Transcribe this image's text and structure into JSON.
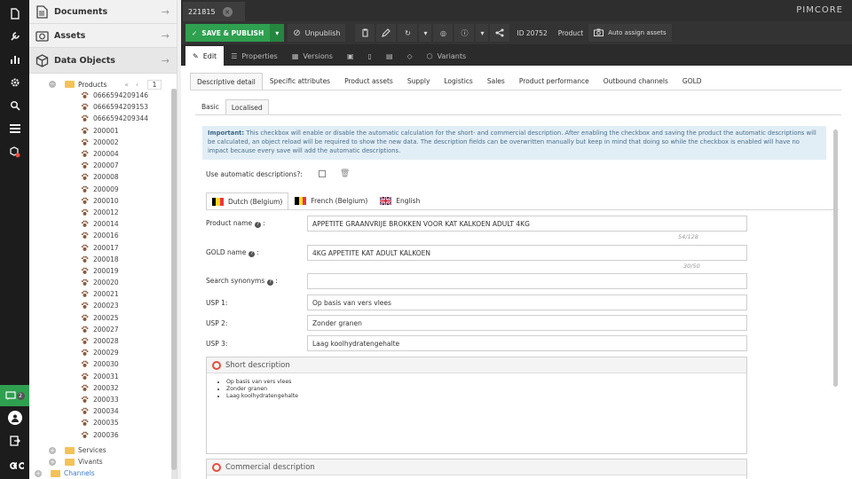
{
  "tree": {
    "sections": [
      {
        "label": "Documents",
        "icon": "document-icon"
      },
      {
        "label": "Assets",
        "icon": "image-icon"
      },
      {
        "label": "Data Objects",
        "icon": "cube-icon"
      }
    ],
    "products_label": "Products",
    "pager_page": "1",
    "items": [
      "0666594209146",
      "0666594209153",
      "0666594209344",
      "200001",
      "200002",
      "200004",
      "200007",
      "200008",
      "200009",
      "200010",
      "200012",
      "200014",
      "200016",
      "200017",
      "200018",
      "200019",
      "200020",
      "200021",
      "200023",
      "200025",
      "200027",
      "200028",
      "200029",
      "200030",
      "200031",
      "200032",
      "200033",
      "200034",
      "200035",
      "200036"
    ],
    "siblings": [
      "Services",
      "Vivants",
      "Channels"
    ]
  },
  "tab": {
    "id": "221815"
  },
  "brand": "PIMCORE",
  "toolbar": {
    "save_publish": "SAVE & PUBLISH",
    "unpublish": "Unpublish",
    "id_label": "ID 20752",
    "class_label": "Product",
    "auto_assign": "Auto assign assets"
  },
  "subtabs": [
    "Edit",
    "Properties",
    "Versions",
    "Variants"
  ],
  "panel_tabs": [
    "Descriptive detail",
    "Specific attributes",
    "Product assets",
    "Supply",
    "Logistics",
    "Sales",
    "Product performance",
    "Outbound channels",
    "GOLD"
  ],
  "local_tabs": [
    "Basic",
    "Localised"
  ],
  "info": {
    "strong": "Important:",
    "text": " This checkbox will enable or disable the automatic calculation for the short- and commercial description. After enabling the checkbox and saving the product the automatic descriptions will be calculated, an object reload will be required to show the new data. The description fields can be overwritten manually but keep in mind that doing so while the checkbox is enabled will have no impact because every save will add the automatic descriptions."
  },
  "auto_label": "Use automatic descriptions?:",
  "languages": [
    "Dutch (Belgium)",
    "French (Belgium)",
    "English"
  ],
  "fields": {
    "product_name": {
      "label": "Product name",
      "value": "APPETITE GRAANVRIJE BROKKEN VOOR KAT KALKOEN ADULT 4KG",
      "count": "54/128"
    },
    "gold_name": {
      "label": "GOLD name",
      "value": "4KG APPETITE KAT ADULT KALKOEN",
      "count": "30/50"
    },
    "search_synonyms": {
      "label": "Search synonyms",
      "value": ""
    },
    "usp1": {
      "label": "USP 1:",
      "value": "Op basis van vers vlees"
    },
    "usp2": {
      "label": "USP 2:",
      "value": "Zonder granen"
    },
    "usp3": {
      "label": "USP 3:",
      "value": "Laag koolhydratengehalte"
    }
  },
  "short_description": {
    "title": "Short description",
    "bullets": [
      "Op basis van vers vlees",
      "Zonder granen",
      "Laag koolhydratengehalte"
    ]
  },
  "commercial_description": {
    "title": "Commercial description"
  },
  "notifications": "2"
}
